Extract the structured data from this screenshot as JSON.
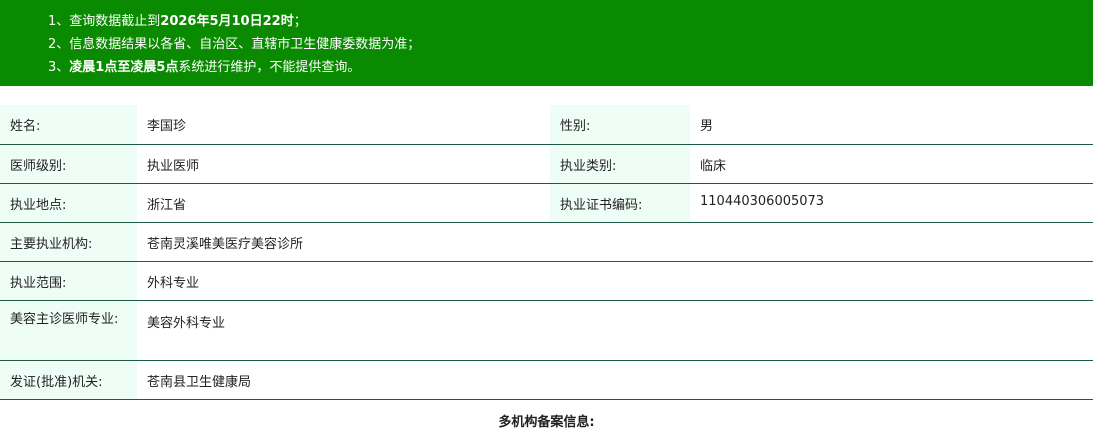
{
  "notice": {
    "line1_prefix": "1、查询数据截止到",
    "line1_bold": "2026年5月10日22时",
    "line1_suffix": "；",
    "line2": "2、信息数据结果以各省、自治区、直辖市卫生健康委数据为准；",
    "line3_prefix": "3、",
    "line3_bold": "凌晨1点至凌晨5点",
    "line3_suffix": "系统进行维护，不能提供查询。"
  },
  "doctor": {
    "name_label": "姓名:",
    "name": "李国珍",
    "gender_label": "性别:",
    "gender": "男",
    "level_label": "医师级别:",
    "level": "执业医师",
    "category_label": "执业类别:",
    "category": "临床",
    "location_label": "执业地点:",
    "location": "浙江省",
    "certificate_label": "执业证书编码:",
    "certificate": "110440306005073",
    "institution_label": "主要执业机构:",
    "institution": "苍南灵溪唯美医疗美容诊所",
    "scope_label": "执业范围:",
    "scope": "外科专业",
    "beauty_label": "美容主诊医师专业:",
    "beauty": "美容外科专业",
    "authority_label": "发证(批准)机关:",
    "authority": "苍南县卫生健康局"
  },
  "multi_institution_title": "多机构备案信息:",
  "colors": {
    "notice_bg": "#0a8a00",
    "label_bg": "#effdf7",
    "row_border": "#1e5a45"
  }
}
